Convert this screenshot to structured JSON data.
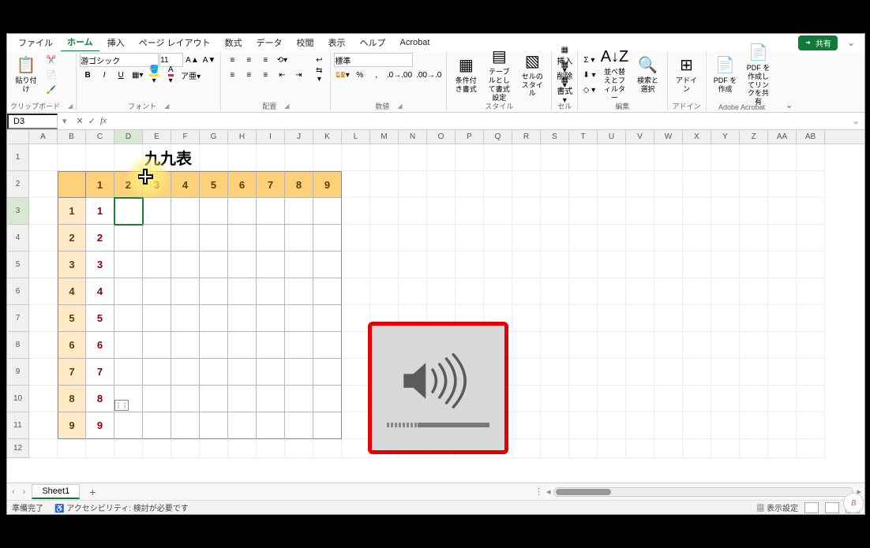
{
  "menu": {
    "tabs": [
      "ファイル",
      "ホーム",
      "挿入",
      "ページ レイアウト",
      "数式",
      "データ",
      "校閲",
      "表示",
      "ヘルプ",
      "Acrobat"
    ],
    "active_index": 1,
    "share": "共有"
  },
  "ribbon": {
    "clipboard": {
      "paste": "貼り付け",
      "label": "クリップボード"
    },
    "font": {
      "name": "游ゴシック",
      "size": "11",
      "label": "フォント"
    },
    "align": {
      "label": "配置",
      "wrap": "折り返して全体を表示する",
      "merge": "セルを結合して中央揃え"
    },
    "number": {
      "format": "標準",
      "label": "数値"
    },
    "styles": {
      "cond": "条件付き書式",
      "table": "テーブルとして書式設定",
      "cell": "セルのスタイル",
      "label": "スタイル"
    },
    "cells": {
      "insert": "挿入",
      "delete": "削除",
      "format": "書式",
      "label": "セル"
    },
    "editing": {
      "sort": "並べ替えとフィルター",
      "find": "検索と選択",
      "label": "編集"
    },
    "addins": {
      "addin": "アドイン",
      "label": "アドイン"
    },
    "acrobat": {
      "create": "PDF を作成",
      "share": "PDF を作成してリンクを共有",
      "label": "Adobe Acrobat"
    }
  },
  "formula_bar": {
    "namebox": "D3",
    "fx": "fx",
    "formula": ""
  },
  "grid": {
    "cols": [
      "A",
      "B",
      "C",
      "D",
      "E",
      "F",
      "G",
      "H",
      "I",
      "J",
      "K",
      "L",
      "M",
      "N",
      "O",
      "P",
      "Q",
      "R",
      "S",
      "T",
      "U",
      "V",
      "W",
      "X",
      "Y",
      "Z",
      "AA",
      "AB"
    ],
    "rows": [
      1,
      2,
      3,
      4,
      5,
      6,
      7,
      8,
      9,
      10,
      11,
      12
    ],
    "title": "九九表",
    "col_headers": [
      1,
      2,
      3,
      4,
      5,
      6,
      7,
      8,
      9
    ],
    "row_headers": [
      1,
      2,
      3,
      4,
      5,
      6,
      7,
      8,
      9
    ],
    "c_values": [
      1,
      2,
      3,
      4,
      5,
      6,
      7,
      8,
      9
    ],
    "selected_cell": "D3",
    "selected_col": "D",
    "selected_row": 3
  },
  "sheetbar": {
    "sheet": "Sheet1",
    "add": "+"
  },
  "status": {
    "ready": "準備完了",
    "access": "アクセシビリティ: 検討が必要です",
    "display": "表示設定"
  },
  "chart_data": {
    "type": "table",
    "title": "九九表",
    "row_headers": [
      1,
      2,
      3,
      4,
      5,
      6,
      7,
      8,
      9
    ],
    "col_headers": [
      1,
      2,
      3,
      4,
      5,
      6,
      7,
      8,
      9
    ],
    "filled_column_C": [
      1,
      2,
      3,
      4,
      5,
      6,
      7,
      8,
      9
    ],
    "note": "Only column C (row_header × 1) is filled; D3 is active/empty."
  }
}
